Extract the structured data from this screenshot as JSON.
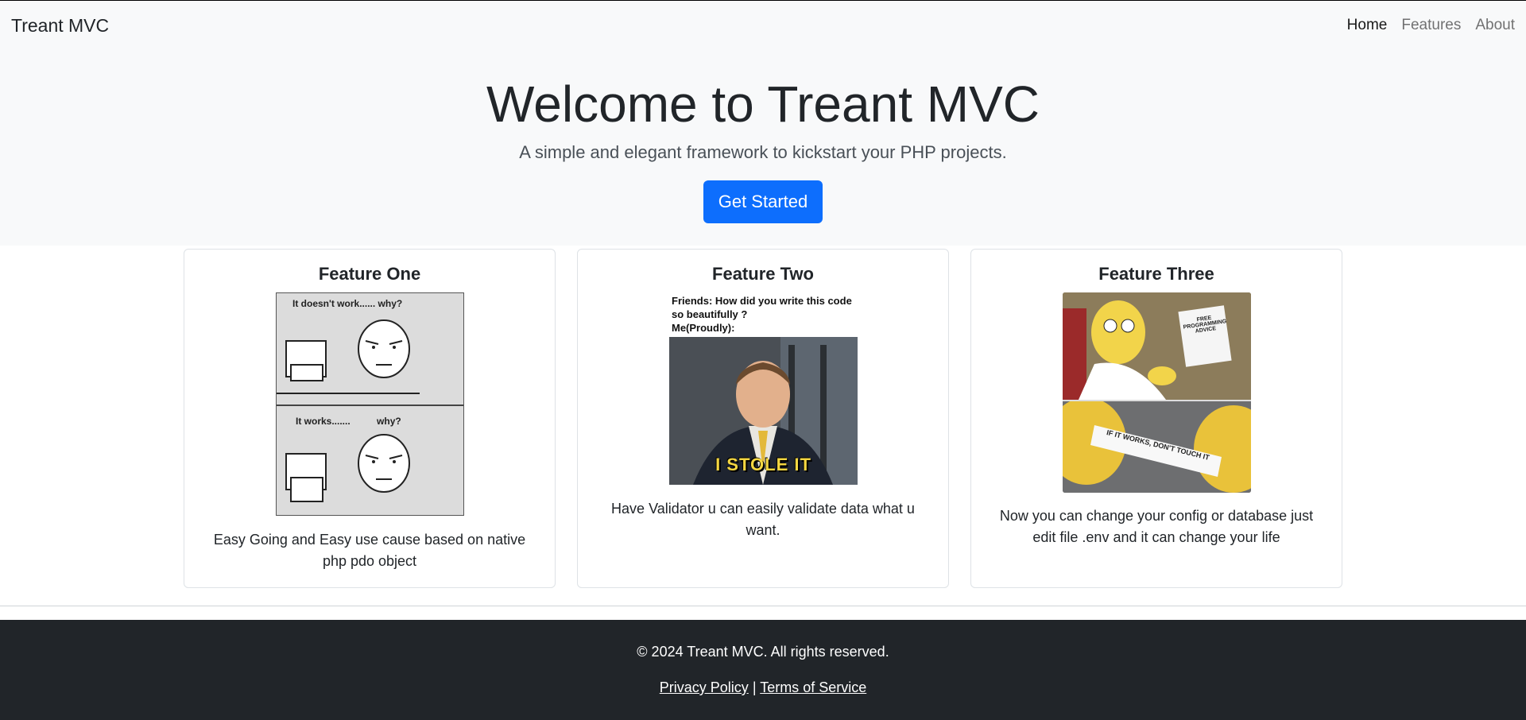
{
  "navbar": {
    "brand": "Treant MVC",
    "links": [
      {
        "label": "Home",
        "active": true
      },
      {
        "label": "Features",
        "active": false
      },
      {
        "label": "About",
        "active": false
      }
    ]
  },
  "hero": {
    "title": "Welcome to Treant MVC",
    "lead": "A simple and elegant framework to kickstart your PHP projects.",
    "button_label": "Get Started"
  },
  "features": [
    {
      "title": "Feature One",
      "text": "Easy Going and Easy use cause based on native php pdo object",
      "image_text_top": "It doesn't work...... why?",
      "image_text_bottom": "It works.......          why?"
    },
    {
      "title": "Feature Two",
      "text": "Have Validator u can easily validate data what u want.",
      "image_caption": "Friends: How did you write this code so beautifully ?\nMe(Proudly):",
      "image_overlay": "I STOLE IT"
    },
    {
      "title": "Feature Three",
      "text": "Now you can change your config or database just edit file .env and it can change your life",
      "image_sign": "FREE PROGRAMMING ADVICE",
      "image_paper": "IF IT WORKS, DON'T TOUCH IT"
    }
  ],
  "footer": {
    "copyright": "© 2024 Treant MVC. All rights reserved.",
    "privacy": "Privacy Policy",
    "separator": "|",
    "terms": "Terms of Service"
  },
  "colors": {
    "primary": "#0d6efd",
    "navbar_bg": "#f8f9fa",
    "footer_bg": "#212529"
  }
}
